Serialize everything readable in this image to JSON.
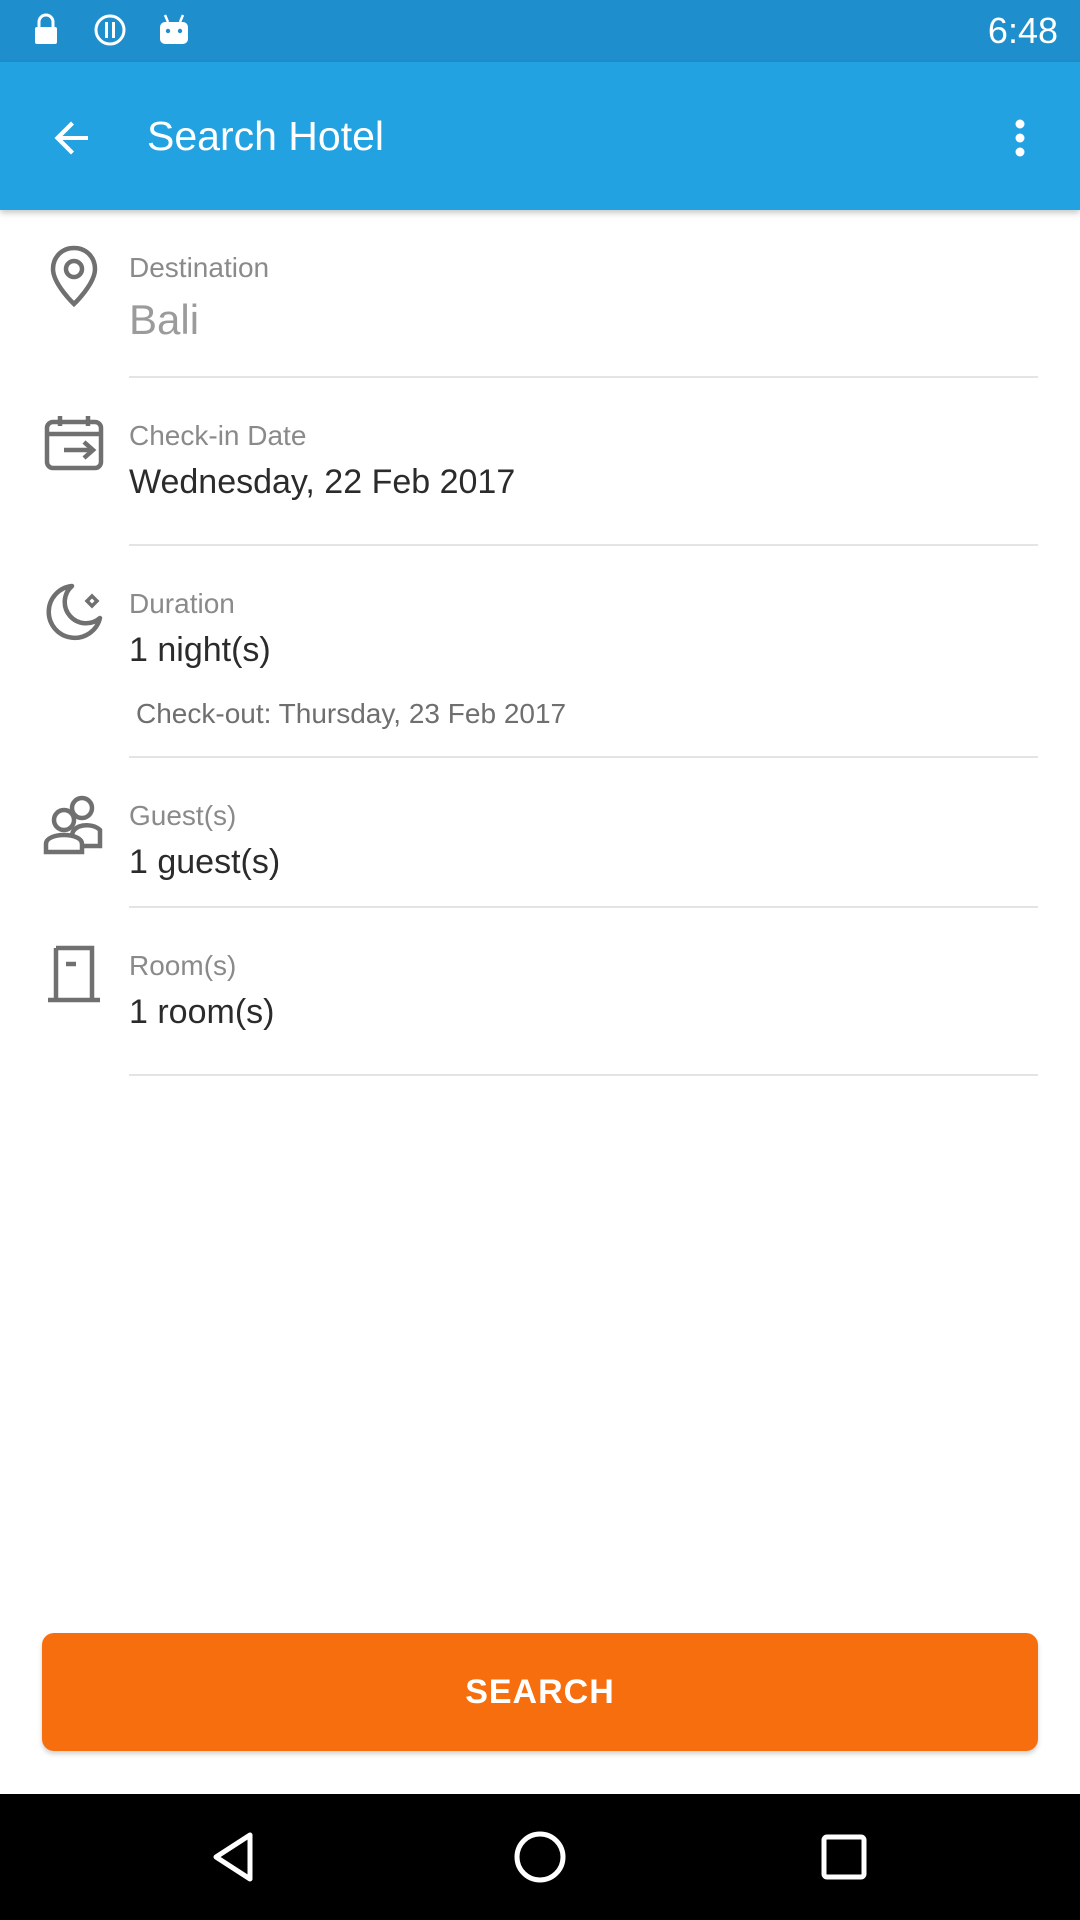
{
  "status_bar": {
    "time": "6:48",
    "icons": [
      "lock-icon",
      "data-saver-icon",
      "android-icon"
    ]
  },
  "app_bar": {
    "title": "Search Hotel",
    "back_icon": "arrow-back-icon",
    "menu_icon": "more-vert-icon"
  },
  "form": {
    "destination": {
      "label": "Destination",
      "value": "Bali",
      "icon": "location-pin-icon"
    },
    "checkin": {
      "label": "Check-in Date",
      "value": "Wednesday, 22 Feb 2017",
      "icon": "calendar-icon"
    },
    "duration": {
      "label": "Duration",
      "value": "1 night(s)",
      "checkout": "Check-out: Thursday, 23 Feb 2017",
      "icon": "moon-icon"
    },
    "guests": {
      "label": "Guest(s)",
      "value": "1 guest(s)",
      "icon": "people-icon"
    },
    "rooms": {
      "label": "Room(s)",
      "value": "1 room(s)",
      "icon": "door-icon"
    }
  },
  "search_button": {
    "label": "SEARCH"
  },
  "nav_bar": {
    "icons": [
      "back-triangle-icon",
      "home-circle-icon",
      "recents-square-icon"
    ]
  },
  "colors": {
    "status_bar": "#1E8FCC",
    "app_bar": "#22A2E0",
    "accent": "#F76E0E",
    "label_gray": "#8A8A8A",
    "icon_gray": "#707070"
  }
}
